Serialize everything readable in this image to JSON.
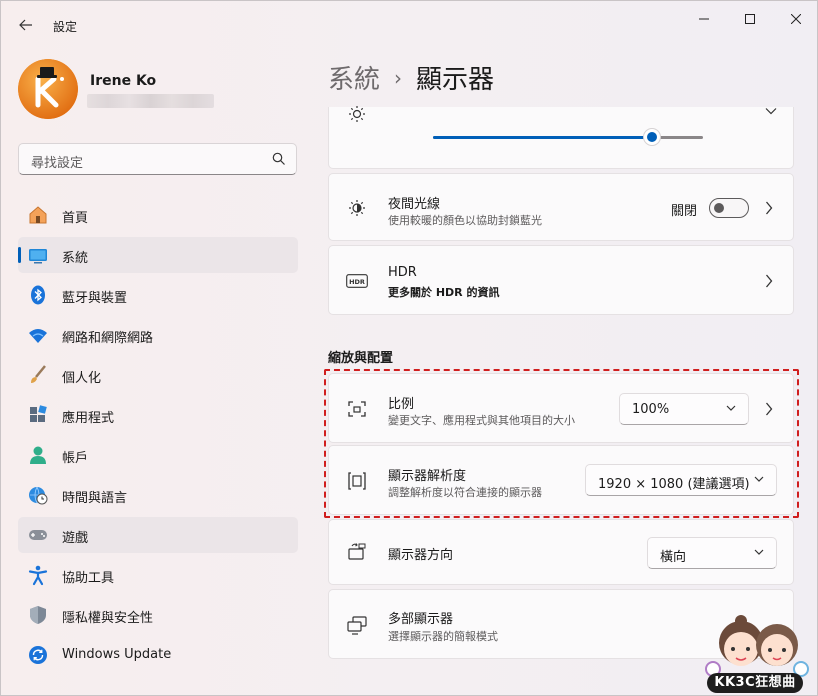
{
  "window": {
    "app_title": "設定"
  },
  "profile": {
    "name": "Irene Ko"
  },
  "search": {
    "placeholder": "尋找設定"
  },
  "sidebar": {
    "items": [
      {
        "label": "首頁",
        "icon": "home-icon"
      },
      {
        "label": "系統",
        "icon": "system-icon",
        "active": true
      },
      {
        "label": "藍牙與裝置",
        "icon": "bluetooth-icon"
      },
      {
        "label": "網路和網際網路",
        "icon": "wifi-icon"
      },
      {
        "label": "個人化",
        "icon": "brush-icon"
      },
      {
        "label": "應用程式",
        "icon": "apps-icon"
      },
      {
        "label": "帳戶",
        "icon": "account-icon"
      },
      {
        "label": "時間與語言",
        "icon": "globe-clock-icon"
      },
      {
        "label": "遊戲",
        "icon": "gamepad-icon"
      },
      {
        "label": "協助工具",
        "icon": "accessibility-icon"
      },
      {
        "label": "隱私權與安全性",
        "icon": "shield-icon"
      },
      {
        "label": "Windows Update",
        "icon": "update-icon"
      }
    ]
  },
  "breadcrumb": {
    "parent": "系統",
    "separator": "›",
    "current": "顯示器"
  },
  "brightness": {
    "value_fraction": 0.81
  },
  "night_light": {
    "title": "夜間光線",
    "subtitle": "使用較暖的顏色以協助封鎖藍光",
    "state_label": "關閉"
  },
  "hdr": {
    "title": "HDR",
    "link": "更多關於 HDR 的資訊",
    "icon_label": "HDR"
  },
  "scale_layout": {
    "section_title": "縮放與配置",
    "scale": {
      "title": "比例",
      "subtitle": "變更文字、應用程式與其他項目的大小",
      "value": "100%"
    },
    "resolution": {
      "title": "顯示器解析度",
      "subtitle": "調整解析度以符合連接的顯示器",
      "value": "1920 × 1080 (建議選項)"
    },
    "orientation": {
      "title": "顯示器方向",
      "value": "橫向"
    },
    "multi_display": {
      "title": "多部顯示器",
      "subtitle": "選擇顯示器的簡報模式"
    }
  },
  "watermark": {
    "text": "KK3C狂想曲"
  },
  "colors": {
    "accent": "#005fb8",
    "highlight_border": "#d01e1e"
  }
}
